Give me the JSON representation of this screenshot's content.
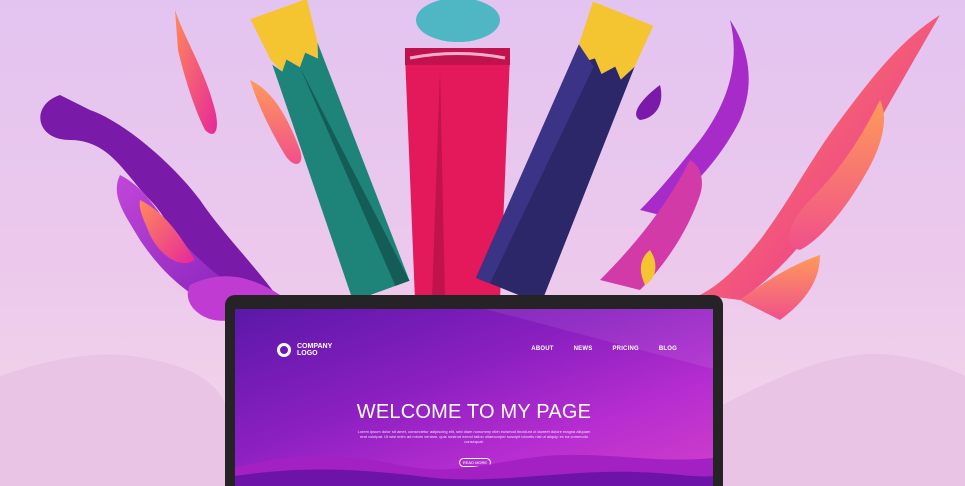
{
  "colors": {
    "background": "#e6c6ef",
    "laptop_bezel": "#262327",
    "screen_purple": "#8a1fc0",
    "pencil_yellow": "#f5c431",
    "pencil_teal": "#1e8479",
    "brush_red": "#e4195b",
    "pencil_navy": "#2c2768",
    "splash_pink": "#ff5a8e",
    "splash_purple": "#9a2bcc"
  },
  "icons": {
    "logo": "ring-icon"
  },
  "website": {
    "logo_text": "COMPANY LOGO",
    "nav": [
      "ABOUT",
      "NEWS",
      "PRICING",
      "BLOG"
    ],
    "hero_title": "WELCOME TO MY PAGE",
    "hero_body": "Lorem ipsum dolor sit amet, consectetur adipiscing elit, sed diam nonummy nibh euismod tincidunt ut laoreet dolore magna aliquam erat volutpat. Ut wisi enim ad minim veniam, quis nostrud exerci tation ullamcorper suscipit lobortis nisl ut aliquip ex ea commodo consequat.",
    "cta_label": "READ MORE"
  }
}
